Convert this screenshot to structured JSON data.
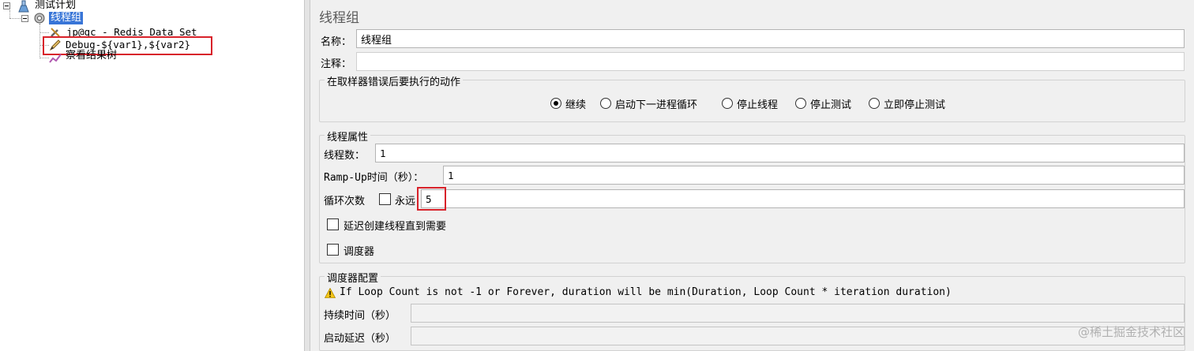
{
  "tree": {
    "root": "测试计划",
    "thread_group": "线程组",
    "items": [
      {
        "label": "jp@gc - Redis Data Set",
        "icon": "wrench-icon"
      },
      {
        "label": "Debug-${var1},${var2}",
        "icon": "pencil-icon"
      },
      {
        "label": "察看结果树",
        "icon": "chart-icon"
      }
    ]
  },
  "panel": {
    "title": "线程组",
    "name_label": "名称：",
    "name_value": "线程组",
    "comment_label": "注释：",
    "comment_value": "",
    "error_group_title": "在取样器错误后要执行的动作",
    "error_options": [
      {
        "label": "继续",
        "selected": true
      },
      {
        "label": "启动下一进程循环",
        "selected": false
      },
      {
        "label": "停止线程",
        "selected": false
      },
      {
        "label": "停止测试",
        "selected": false
      },
      {
        "label": "立即停止测试",
        "selected": false
      }
    ],
    "thread_props_title": "线程属性",
    "threads_label": "线程数：",
    "threads_value": "1",
    "rampup_label_prefix": "Ramp-Up",
    "rampup_label_suffix": "时间（秒）：",
    "rampup_value": "1",
    "loop_label": "循环次数",
    "forever_label": "永远",
    "forever_checked": false,
    "loop_value": "5",
    "delay_label": "延迟创建线程直到需要",
    "delay_checked": false,
    "scheduler_label": "调度器",
    "scheduler_checked": false,
    "scheduler_group_title": "调度器配置",
    "warning_text": "If Loop Count is not -1 or Forever, duration will be min(Duration, Loop Count * iteration duration)",
    "duration_label": "持续时间（秒）",
    "duration_value": "",
    "startup_delay_label": "启动延迟（秒）",
    "startup_delay_value": ""
  },
  "watermark": "@稀土掘金技术社区"
}
